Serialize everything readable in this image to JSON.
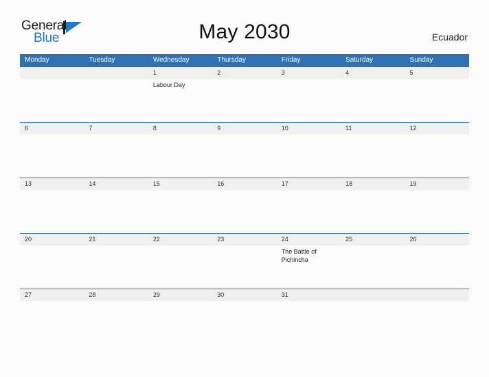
{
  "logo": {
    "word_top": "General",
    "word_bottom": "Blue",
    "flag_icon": "blue-flag-triangle-icon",
    "flag_color": "#1f7bc4",
    "bar_color": "#1a1a1a"
  },
  "header": {
    "title": "May 2030",
    "country": "Ecuador"
  },
  "colors": {
    "header_blue": "#2e72b4",
    "band_gray": "#f0f0f0",
    "page_background": "#fbfbfb",
    "text_dark": "#222222"
  },
  "calendar": {
    "weekdays": [
      "Monday",
      "Tuesday",
      "Wednesday",
      "Thursday",
      "Friday",
      "Saturday",
      "Sunday"
    ],
    "weeks": [
      {
        "days": [
          {
            "date": "",
            "event": ""
          },
          {
            "date": "",
            "event": ""
          },
          {
            "date": "1",
            "event": "Labour Day"
          },
          {
            "date": "2",
            "event": ""
          },
          {
            "date": "3",
            "event": ""
          },
          {
            "date": "4",
            "event": ""
          },
          {
            "date": "5",
            "event": ""
          }
        ]
      },
      {
        "days": [
          {
            "date": "6",
            "event": ""
          },
          {
            "date": "7",
            "event": ""
          },
          {
            "date": "8",
            "event": ""
          },
          {
            "date": "9",
            "event": ""
          },
          {
            "date": "10",
            "event": ""
          },
          {
            "date": "11",
            "event": ""
          },
          {
            "date": "12",
            "event": ""
          }
        ]
      },
      {
        "days": [
          {
            "date": "13",
            "event": ""
          },
          {
            "date": "14",
            "event": ""
          },
          {
            "date": "15",
            "event": ""
          },
          {
            "date": "16",
            "event": ""
          },
          {
            "date": "17",
            "event": ""
          },
          {
            "date": "18",
            "event": ""
          },
          {
            "date": "19",
            "event": ""
          }
        ]
      },
      {
        "days": [
          {
            "date": "20",
            "event": ""
          },
          {
            "date": "21",
            "event": ""
          },
          {
            "date": "22",
            "event": ""
          },
          {
            "date": "23",
            "event": ""
          },
          {
            "date": "24",
            "event": "The Battle of Pichincha"
          },
          {
            "date": "25",
            "event": ""
          },
          {
            "date": "26",
            "event": ""
          }
        ]
      },
      {
        "days": [
          {
            "date": "27",
            "event": ""
          },
          {
            "date": "28",
            "event": ""
          },
          {
            "date": "29",
            "event": ""
          },
          {
            "date": "30",
            "event": ""
          },
          {
            "date": "31",
            "event": ""
          },
          {
            "date": "",
            "event": ""
          },
          {
            "date": "",
            "event": ""
          }
        ]
      }
    ]
  }
}
